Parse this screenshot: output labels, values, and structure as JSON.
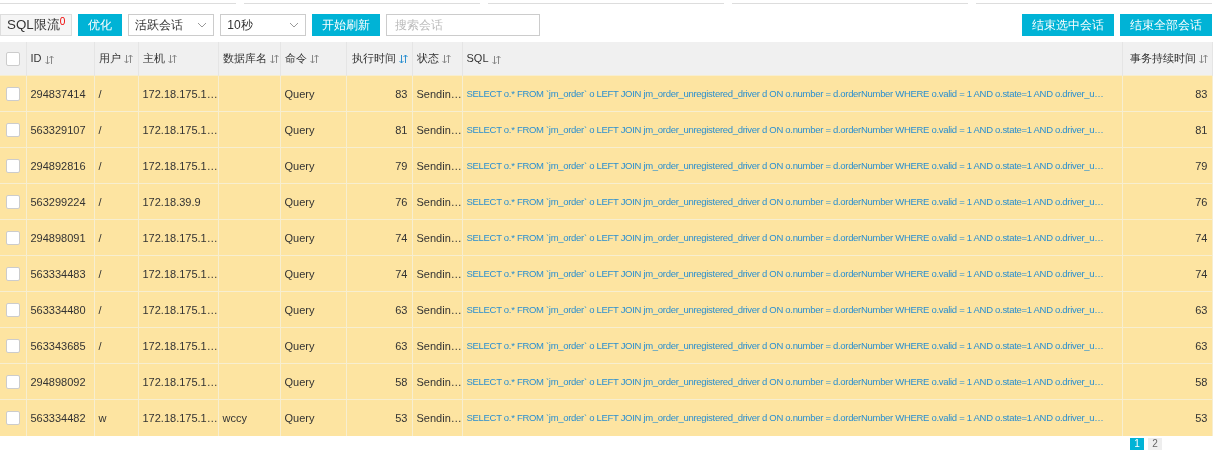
{
  "toolbar": {
    "limit_button": {
      "label": "SQL限流",
      "badge": "0"
    },
    "optimize_button": "优化",
    "session_select": "活跃会话",
    "interval_select": "10秒",
    "refresh_button": "开始刷新",
    "search": {
      "placeholder": "搜索会话"
    },
    "actions": [
      "结束选中会话",
      "结束全部会话"
    ]
  },
  "table": {
    "all_checked": false,
    "columns": [
      {
        "label": "ID",
        "sorted": false
      },
      {
        "label": "用户",
        "sorted": false
      },
      {
        "label": "主机",
        "sorted": false
      },
      {
        "label": "数据库名",
        "sorted": false
      },
      {
        "label": "命令",
        "sorted": false
      },
      {
        "label": "执行时间",
        "sorted": true
      },
      {
        "label": "状态",
        "sorted": false
      },
      {
        "label": "SQL",
        "sorted": false
      },
      {
        "label": "事务持续时间",
        "sorted": false
      }
    ],
    "rows": [
      {
        "checked": false,
        "cells": [
          "294837414",
          "/",
          "172.18.175.1…",
          "",
          "Query",
          "83",
          "Sendin…",
          "SELECT o.* FROM `jm_order` o LEFT JOIN jm_order_unregistered_driver d ON o.number = d.orderNumber WHERE o.valid = 1 AND o.state=1 AND o.driver_u…",
          "83"
        ]
      },
      {
        "checked": false,
        "cells": [
          "563329107",
          "/",
          "172.18.175.1…",
          "",
          "Query",
          "81",
          "Sendin…",
          "SELECT o.* FROM `jm_order` o LEFT JOIN jm_order_unregistered_driver d ON o.number = d.orderNumber WHERE o.valid = 1 AND o.state=1 AND o.driver_u…",
          "81"
        ]
      },
      {
        "checked": false,
        "cells": [
          "294892816",
          "/",
          "172.18.175.1…",
          "",
          "Query",
          "79",
          "Sendin…",
          "SELECT o.* FROM `jm_order` o LEFT JOIN jm_order_unregistered_driver d ON o.number = d.orderNumber WHERE o.valid = 1 AND o.state=1 AND o.driver_u…",
          "79"
        ]
      },
      {
        "checked": false,
        "cells": [
          "563299224",
          "/",
          "172.18.39.9",
          "",
          "Query",
          "76",
          "Sendin…",
          "SELECT o.* FROM `jm_order` o LEFT JOIN jm_order_unregistered_driver d ON o.number = d.orderNumber WHERE o.valid = 1 AND o.state=1 AND o.driver_u…",
          "76"
        ]
      },
      {
        "checked": false,
        "cells": [
          "294898091",
          "/",
          "172.18.175.1…",
          "",
          "Query",
          "74",
          "Sendin…",
          "SELECT o.* FROM `jm_order` o LEFT JOIN jm_order_unregistered_driver d ON o.number = d.orderNumber WHERE o.valid = 1 AND o.state=1 AND o.driver_u…",
          "74"
        ]
      },
      {
        "checked": false,
        "cells": [
          "563334483",
          "/",
          "172.18.175.1…",
          "",
          "Query",
          "74",
          "Sendin…",
          "SELECT o.* FROM `jm_order` o LEFT JOIN jm_order_unregistered_driver d ON o.number = d.orderNumber WHERE o.valid = 1 AND o.state=1 AND o.driver_u…",
          "74"
        ]
      },
      {
        "checked": false,
        "cells": [
          "563334480",
          "/",
          "172.18.175.1…",
          "",
          "Query",
          "63",
          "Sendin…",
          "SELECT o.* FROM `jm_order` o LEFT JOIN jm_order_unregistered_driver d ON o.number = d.orderNumber WHERE o.valid = 1 AND o.state=1 AND o.driver_u…",
          "63"
        ]
      },
      {
        "checked": false,
        "cells": [
          "563343685",
          "/",
          "172.18.175.1…",
          "",
          "Query",
          "63",
          "Sendin…",
          "SELECT o.* FROM `jm_order` o LEFT JOIN jm_order_unregistered_driver d ON o.number = d.orderNumber WHERE o.valid = 1 AND o.state=1 AND o.driver_u…",
          "63"
        ]
      },
      {
        "checked": false,
        "cells": [
          "294898092",
          "",
          "172.18.175.1…",
          "",
          "Query",
          "58",
          "Sendin…",
          "SELECT o.* FROM `jm_order` o LEFT JOIN jm_order_unregistered_driver d ON o.number = d.orderNumber WHERE o.valid = 1 AND o.state=1 AND o.driver_u…",
          "58"
        ]
      },
      {
        "checked": false,
        "cells": [
          "563334482",
          "w",
          "172.18.175.1…",
          "wccy",
          "Query",
          "53",
          "Sendin…",
          "SELECT o.* FROM `jm_order` o LEFT JOIN jm_order_unregistered_driver d ON o.number = d.orderNumber WHERE o.valid = 1 AND o.state=1 AND o.driver_u…",
          "53"
        ]
      }
    ]
  },
  "pagination": {
    "pages": [
      {
        "label": "1",
        "selected": true
      },
      {
        "label": "2",
        "selected": false
      }
    ]
  }
}
